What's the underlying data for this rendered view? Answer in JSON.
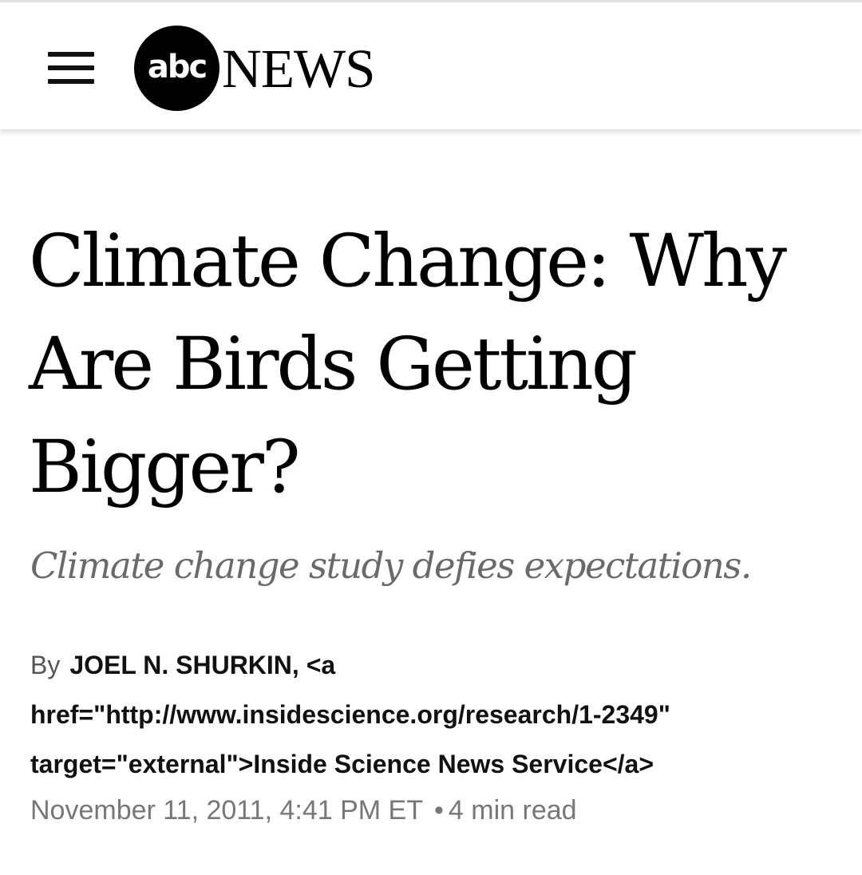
{
  "header": {
    "menu_icon": "hamburger-menu-icon",
    "logo": {
      "circle_text": "abc",
      "wordmark": "NEWS"
    }
  },
  "article": {
    "headline": "Climate Change: Why Are Birds Getting Bigger?",
    "subheadline": "Climate change study defies expectations.",
    "byline": {
      "prefix": "By",
      "author_text": "JOEL N. SHURKIN, <a href=\"http://www.insidescience.org/research/1-2349\" target=\"external\">Inside Science News Service</a>"
    },
    "date": "November 11, 2011, 4:41 PM ET",
    "separator": "•",
    "read_time": "4 min read"
  }
}
